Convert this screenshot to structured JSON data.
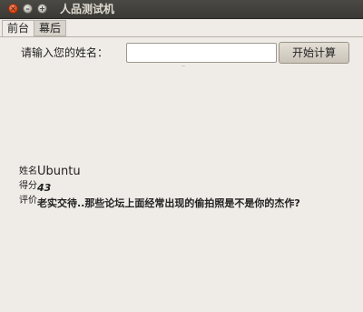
{
  "window": {
    "title": "人品测试机",
    "close_glyph": "×",
    "min_glyph": "–",
    "max_glyph": "+"
  },
  "tabs": [
    {
      "label": "前台",
      "active": true
    },
    {
      "label": "幕后",
      "active": false
    }
  ],
  "form": {
    "name_label": "请输入您的姓名：",
    "name_value": "",
    "calc_button": "开始计算"
  },
  "result": {
    "name_label": "姓名",
    "name_value": "Ubuntu",
    "score_label": "得分",
    "score_value": "43",
    "eval_label": "评价",
    "eval_value": "老实交待..那些论坛上面经常出现的偷拍照是不是你的杰作?"
  }
}
